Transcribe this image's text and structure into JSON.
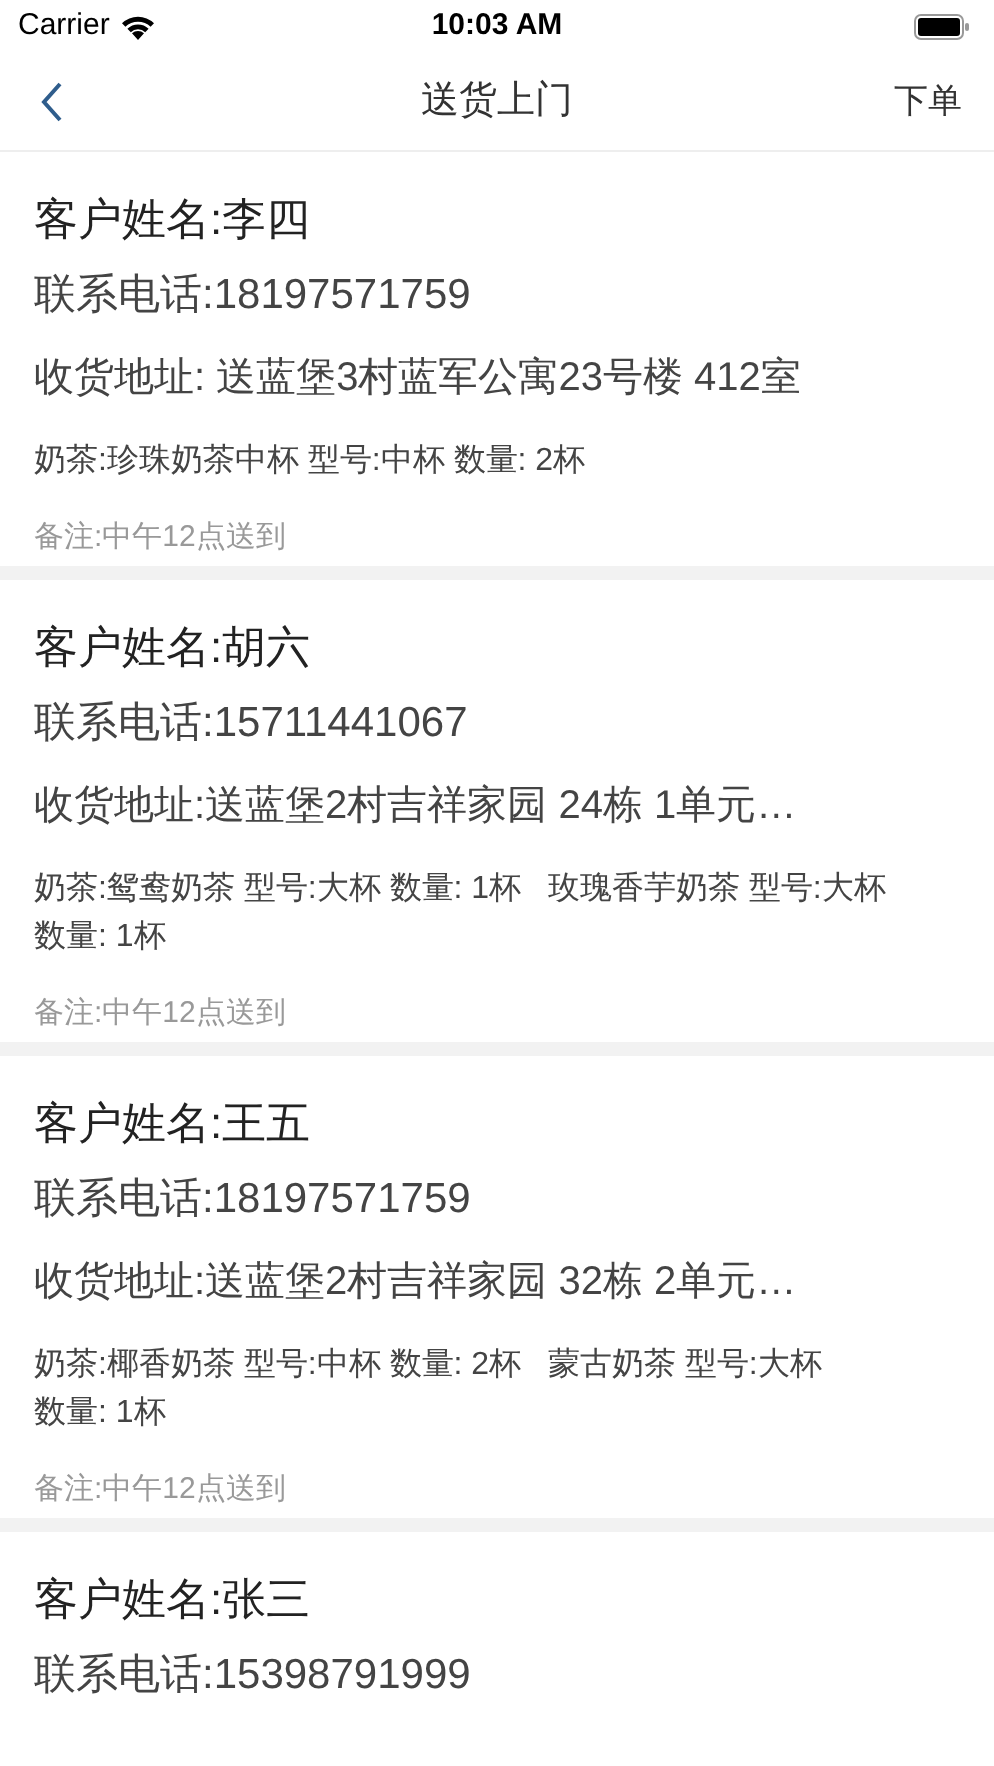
{
  "status_bar": {
    "carrier": "Carrier",
    "time": "10:03 AM"
  },
  "nav": {
    "title": "送货上门",
    "action": "下单"
  },
  "orders": [
    {
      "name": "客户姓名:李四",
      "phone": "联系电话:18197571759",
      "address": "收货地址: 送蓝堡3村蓝军公寓23号楼 412室",
      "items": [
        "奶茶:珍珠奶茶中杯 型号:中杯 数量: 2杯"
      ],
      "note": "备注:中午12点送到"
    },
    {
      "name": "客户姓名:胡六",
      "phone": "联系电话:15711441067",
      "address": "收货地址:送蓝堡2村吉祥家园 24栋 1单元…",
      "items": [
        "奶茶:鸳鸯奶茶 型号:大杯 数量: 1杯   玫瑰香芋奶茶 型号:大杯",
        "数量: 1杯"
      ],
      "note": "备注:中午12点送到"
    },
    {
      "name": "客户姓名:王五",
      "phone": "联系电话:18197571759",
      "address": "收货地址:送蓝堡2村吉祥家园 32栋 2单元…",
      "items": [
        "奶茶:椰香奶茶 型号:中杯 数量: 2杯   蒙古奶茶 型号:大杯",
        "数量: 1杯"
      ],
      "note": "备注:中午12点送到"
    },
    {
      "name": "客户姓名:张三",
      "phone": "联系电话:15398791999"
    }
  ]
}
